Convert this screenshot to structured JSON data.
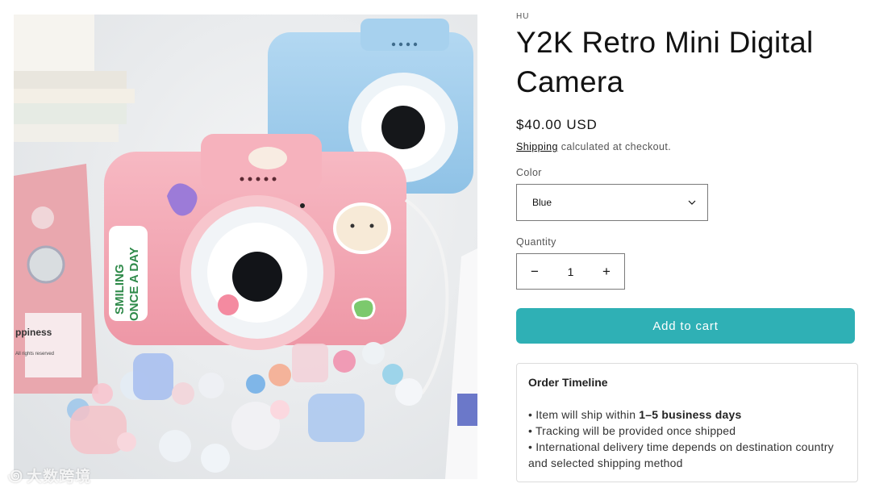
{
  "product": {
    "vendor": "HU",
    "title": "Y2K Retro Mini Digital Camera",
    "price": "$40.00 USD",
    "shipping_link": "Shipping",
    "shipping_rest": " calculated at checkout."
  },
  "image": {
    "sticker_text_line1": "SMILING",
    "sticker_text_line2": "ONCE A DAY",
    "card_text": "ppiness",
    "card_small": "All rights reserved",
    "watermark": "大数跨境"
  },
  "options": {
    "color_label": "Color",
    "color_selected": "Blue",
    "quantity_label": "Quantity",
    "quantity_value": "1",
    "minus": "−",
    "plus": "+"
  },
  "cart": {
    "label": "Add to cart"
  },
  "timeline": {
    "title": "Order Timeline",
    "item1_pre": "• Item will ship within ",
    "item1_bold": "1–5 business days",
    "item2": "• Tracking will be provided once shipped",
    "item3": "• International delivery time depends on destination country and selected shipping method"
  },
  "colors": {
    "accent": "#2fb0b5",
    "camera_pink": "#f3a9b5",
    "camera_blue": "#9ccbea"
  }
}
